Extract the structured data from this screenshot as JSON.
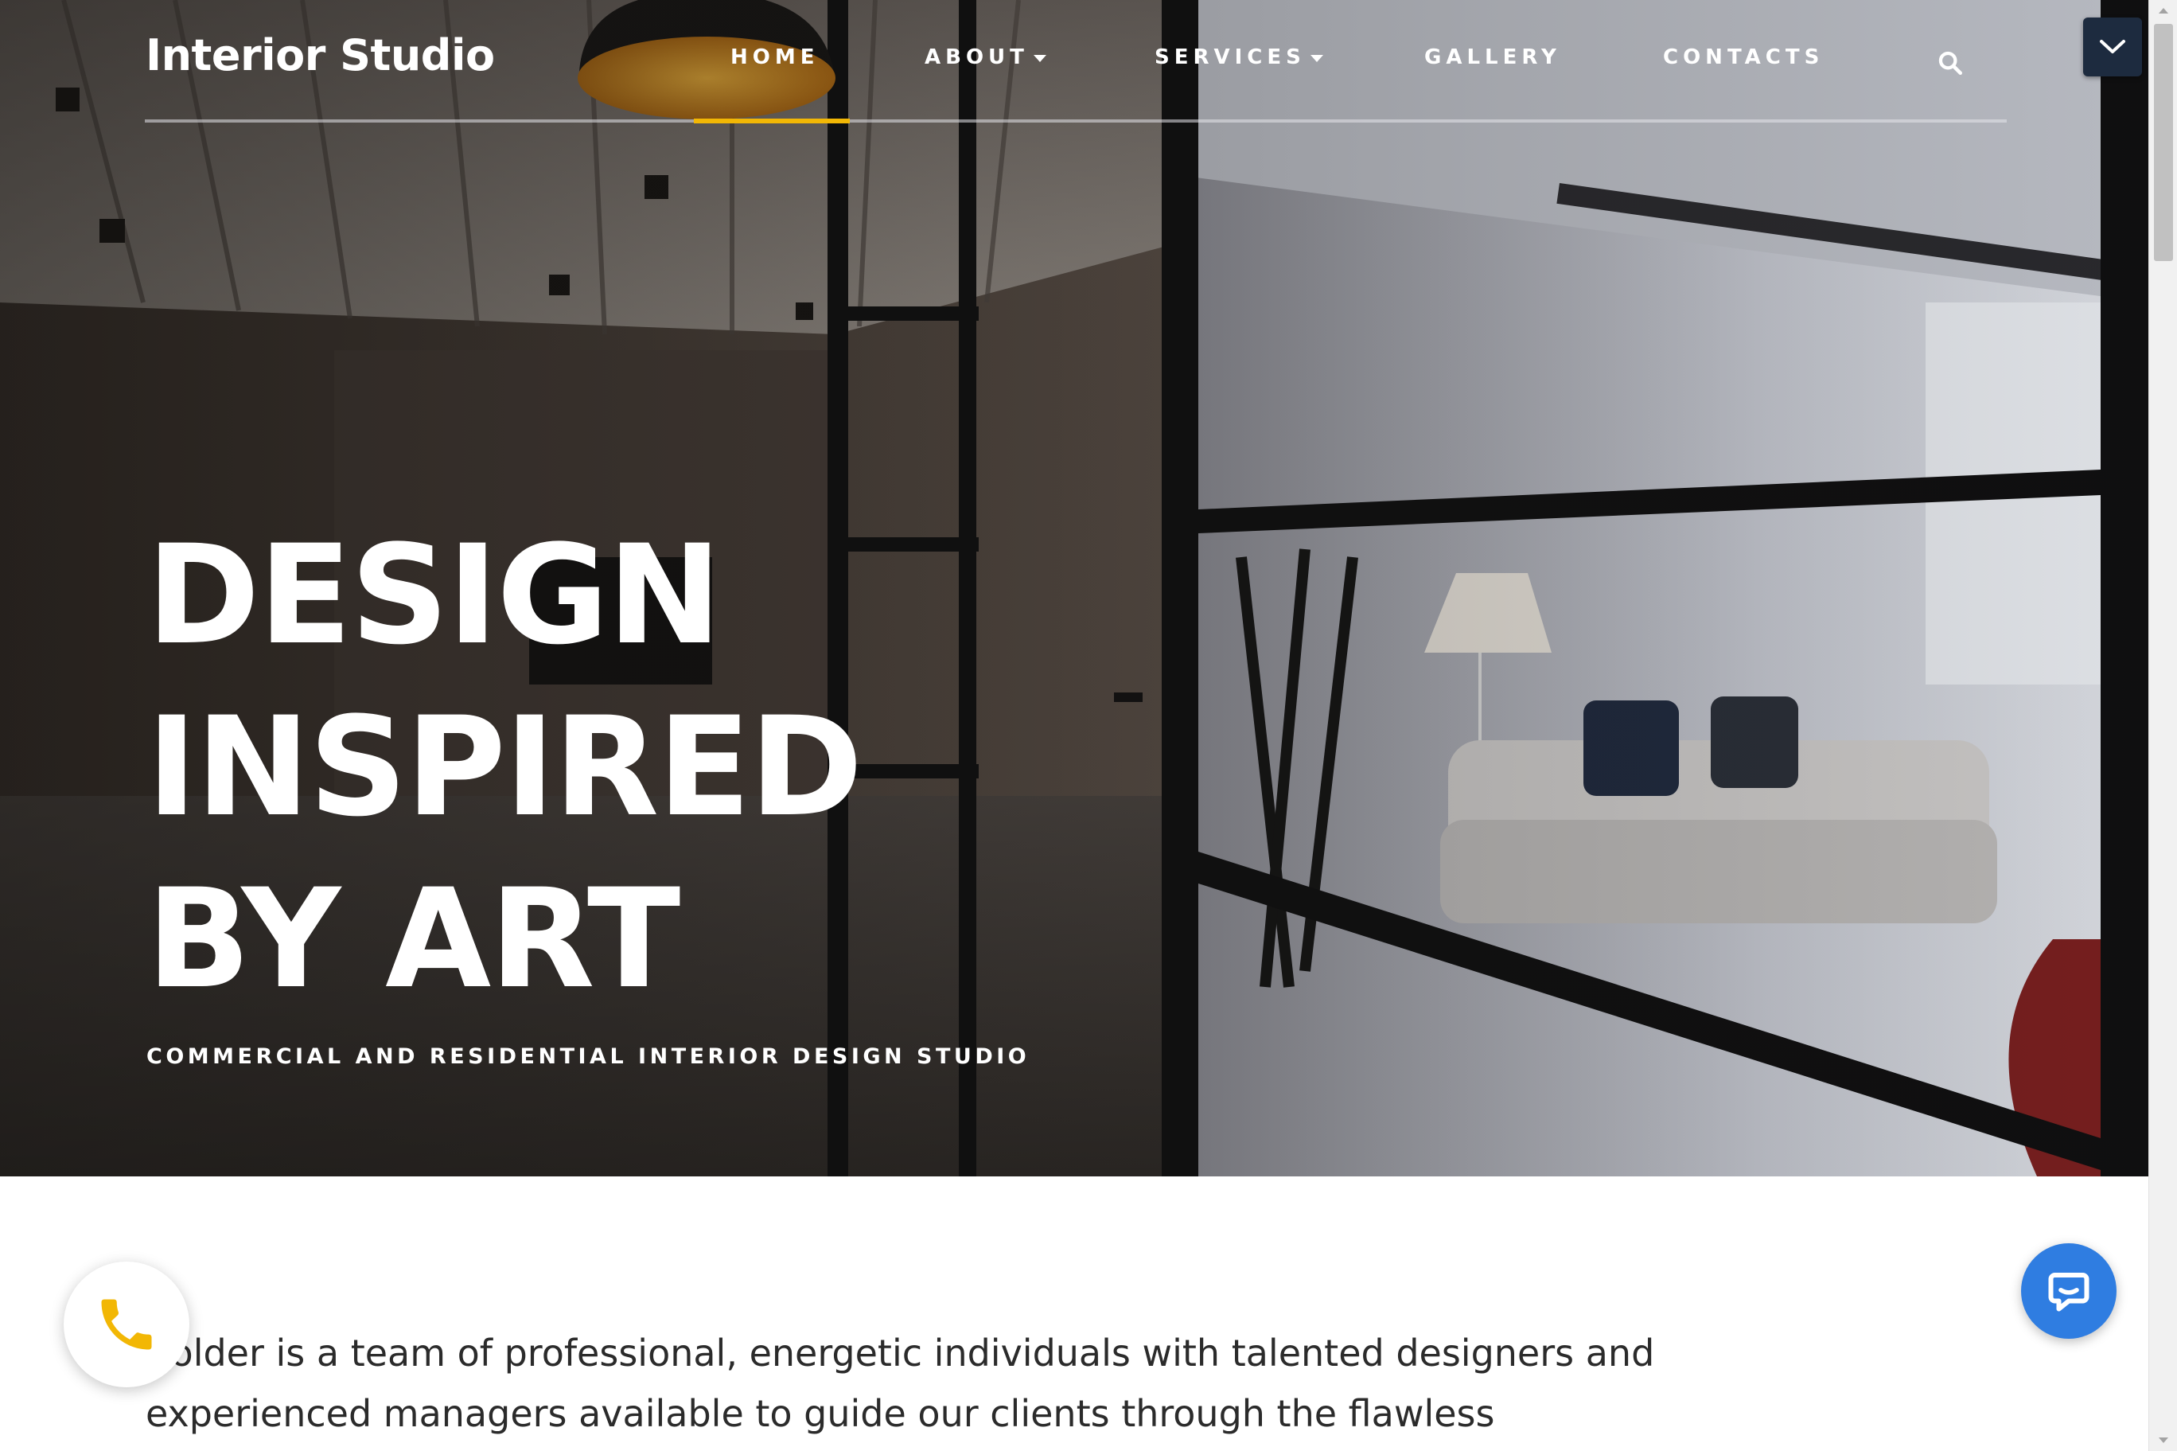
{
  "brand": {
    "name": "Interior Studio"
  },
  "nav": {
    "items": [
      {
        "label": "HOME",
        "active": true,
        "has_dropdown": false
      },
      {
        "label": "ABOUT",
        "active": false,
        "has_dropdown": true
      },
      {
        "label": "SERVICES",
        "active": false,
        "has_dropdown": true
      },
      {
        "label": "GALLERY",
        "active": false,
        "has_dropdown": false
      },
      {
        "label": "CONTACTS",
        "active": false,
        "has_dropdown": false
      }
    ],
    "search_icon": "search-icon",
    "accent_color": "#f2b705"
  },
  "hero": {
    "title_lines": [
      "DESIGN",
      "INSPIRED",
      "BY ART"
    ],
    "subtitle": "COMMERCIAL AND RESIDENTIAL INTERIOR DESIGN STUDIO",
    "background": "interior office with glass partition walls and sofa",
    "scroll_button_icon": "chevron-down-icon",
    "scroll_button_color": "#1d2b3f"
  },
  "intro": {
    "text": "Bolder is a team of professional, energetic individuals with talented designers and experienced managers available to guide our clients through the flawless"
  },
  "floating": {
    "call_icon": "phone-icon",
    "call_icon_color": "#f2b705",
    "chat_icon": "chat-icon",
    "chat_color": "#2f7de1"
  }
}
